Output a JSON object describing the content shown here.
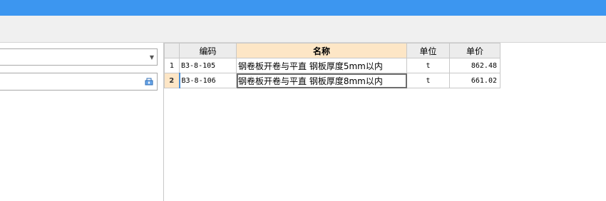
{
  "grid": {
    "columns": [
      "",
      "编码",
      "名称",
      "单位",
      "单价"
    ],
    "rows": [
      {
        "num": "1",
        "code": "B3-8-105",
        "name": "钢卷板开卷与平直 钢板厚度5mm以内",
        "unit": "t",
        "price": "862.48"
      },
      {
        "num": "2",
        "code": "B3-8-106",
        "name": "钢卷板开卷与平直 钢板厚度8mm以内",
        "unit": "t",
        "price": "661.02"
      }
    ]
  },
  "icons": {
    "combo_arrow": "dropdown-arrow-icon",
    "search_button": "basket-search-icon"
  },
  "colors": {
    "titlebar": "#3c96f0",
    "active_header": "#fde6c6"
  }
}
